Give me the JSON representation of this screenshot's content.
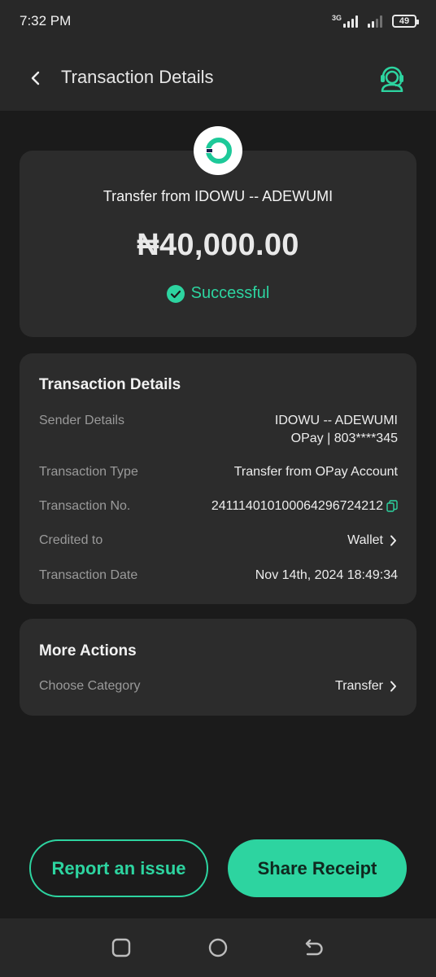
{
  "status_bar": {
    "time": "7:32 PM",
    "network": "3G",
    "battery": "49"
  },
  "header": {
    "title": "Transaction Details",
    "back_icon": "chevron-left-icon",
    "support_icon": "customer-support-icon"
  },
  "summary": {
    "title": "Transfer from IDOWU -- ADEWUMI",
    "amount": "₦40,000.00",
    "status": "Successful",
    "status_color": "#2dd4a0"
  },
  "details": {
    "heading": "Transaction Details",
    "sender_label": "Sender Details",
    "sender_name": "IDOWU -- ADEWUMI",
    "sender_account": "OPay | 803****345",
    "type_label": "Transaction Type",
    "type_value": "Transfer from OPay Account",
    "number_label": "Transaction No.",
    "number_value": "241114010100064296724212",
    "credited_label": "Credited to",
    "credited_value": "Wallet",
    "date_label": "Transaction Date",
    "date_value": "Nov 14th, 2024 18:49:34"
  },
  "more_actions": {
    "heading": "More Actions",
    "category_label": "Choose Category",
    "category_value": "Transfer"
  },
  "buttons": {
    "report": "Report an issue",
    "share": "Share Receipt"
  },
  "colors": {
    "accent": "#2dd4a0",
    "background": "#1b1b1b",
    "card": "#2c2c2c"
  }
}
